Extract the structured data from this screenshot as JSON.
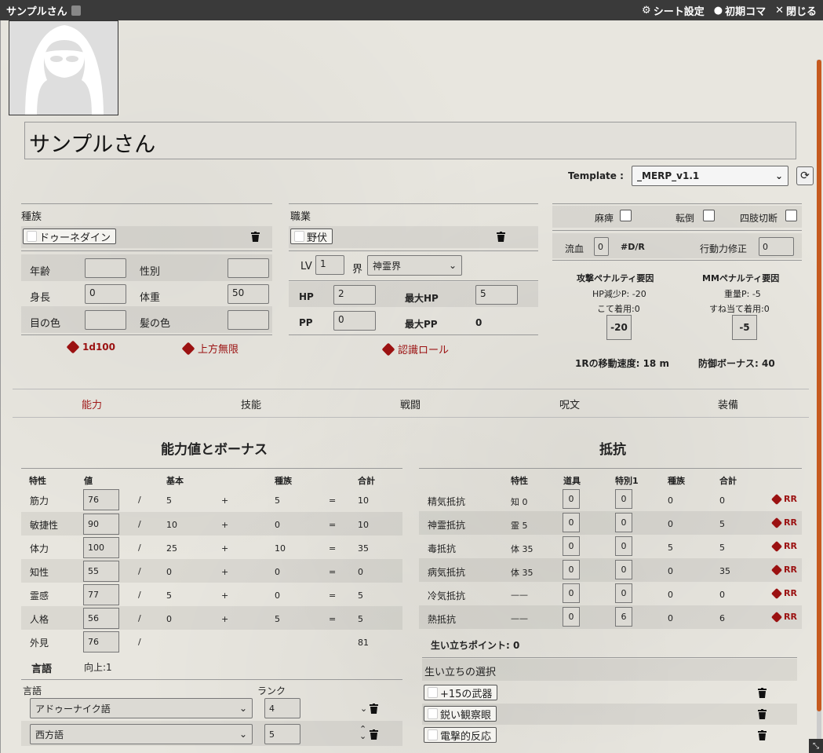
{
  "window": {
    "title": "サンプルさん",
    "actions": {
      "settings": "シート設定",
      "initial_token": "初期コマ",
      "close": "閉じる"
    }
  },
  "character": {
    "name": "サンプルさん"
  },
  "template": {
    "label": "Template :",
    "value": "_MERP_v1.1"
  },
  "race": {
    "title": "種族",
    "value": "ドゥーネダイン",
    "age_label": "年齢",
    "age": "",
    "gender_label": "性別",
    "gender": "",
    "height_label": "身長",
    "height": "0",
    "weight_label": "体重",
    "weight": "50",
    "eye_label": "目の色",
    "eye": "",
    "hair_label": "髪の色",
    "hair": "",
    "roll1": "1d100",
    "roll2": "上方無限"
  },
  "profession": {
    "title": "職業",
    "value": "野伏",
    "lv_label": "LV",
    "lv": "1",
    "realm_label": "界",
    "realm": "神霊界",
    "hp_label": "HP",
    "hp": "2",
    "maxhp_label": "最大HP",
    "maxhp": "5",
    "pp_label": "PP",
    "pp": "0",
    "maxpp_label": "最大PP",
    "maxpp": "0",
    "roll": "認識ロール"
  },
  "status": {
    "paralysis": "麻痺",
    "fall": "転倒",
    "amputation": "四肢切断",
    "bleed_label": "流血",
    "bleed": "0",
    "dr": "#D/R",
    "action_mod_label": "行動力修正",
    "action_mod": "0",
    "attack_pen_title": "攻撃ペナルティ要因",
    "hp_pen": "HP減少P: -20",
    "gauntlet": "こて着用:0",
    "attack_pen_value": "-20",
    "mm_pen_title": "MMペナルティ要因",
    "weight_pen": "重量P: -5",
    "greave": "すね当て着用:0",
    "mm_pen_value": "-5",
    "move_speed": "1Rの移動速度: 18 m",
    "defense_bonus": "防御ボーナス: 40"
  },
  "tabs": [
    "能力",
    "技能",
    "戦闘",
    "呪文",
    "装備"
  ],
  "abilities": {
    "title": "能力値とボーナス",
    "headers": [
      "特性",
      "値",
      "基本",
      "種族",
      "合計"
    ],
    "rows": [
      {
        "name": "筋力",
        "value": "76",
        "base": "5",
        "race": "5",
        "total": "10"
      },
      {
        "name": "敏捷性",
        "value": "90",
        "base": "10",
        "race": "0",
        "total": "10"
      },
      {
        "name": "体力",
        "value": "100",
        "base": "25",
        "race": "10",
        "total": "35"
      },
      {
        "name": "知性",
        "value": "55",
        "base": "0",
        "race": "0",
        "total": "0"
      },
      {
        "name": "霊感",
        "value": "77",
        "base": "5",
        "race": "0",
        "total": "5"
      },
      {
        "name": "人格",
        "value": "56",
        "base": "0",
        "race": "5",
        "total": "5"
      },
      {
        "name": "外見",
        "value": "76",
        "base": "",
        "race": "",
        "total": "81"
      }
    ],
    "ops": {
      "slash": "/",
      "plus": "+",
      "eq": "="
    }
  },
  "languages": {
    "title": "言語",
    "improve": "向上:1",
    "col_lang": "言語",
    "col_rank": "ランク",
    "rows": [
      {
        "lang": "アドゥーナイク語",
        "rank": "4"
      },
      {
        "lang": "西方語",
        "rank": "5"
      }
    ]
  },
  "resistances": {
    "title": "抵抗",
    "headers": [
      "特性",
      "道具",
      "特別1",
      "種族",
      "合計"
    ],
    "rows": [
      {
        "name": "精気抵抗",
        "stat": "知 0",
        "item": "0",
        "special": "0",
        "race": "0",
        "total": "0",
        "rr": "RR"
      },
      {
        "name": "神霊抵抗",
        "stat": "霊 5",
        "item": "0",
        "special": "0",
        "race": "0",
        "total": "5",
        "rr": "RR"
      },
      {
        "name": "毒抵抗",
        "stat": "体 35",
        "item": "0",
        "special": "0",
        "race": "5",
        "total": "5",
        "rr": "RR"
      },
      {
        "name": "病気抵抗",
        "stat": "体 35",
        "item": "0",
        "special": "0",
        "race": "0",
        "total": "35",
        "rr": "RR"
      },
      {
        "name": "冷気抵抗",
        "stat": "——",
        "item": "0",
        "special": "0",
        "race": "0",
        "total": "0",
        "rr": "RR"
      },
      {
        "name": "熱抵抗",
        "stat": "——",
        "item": "0",
        "special": "6",
        "race": "0",
        "total": "6",
        "rr": "RR"
      }
    ]
  },
  "background": {
    "points": "生い立ちポイント: 0",
    "title": "生い立ちの選択",
    "items": [
      "+15の武器",
      "鋭い観察眼",
      "電撃的反応"
    ]
  }
}
